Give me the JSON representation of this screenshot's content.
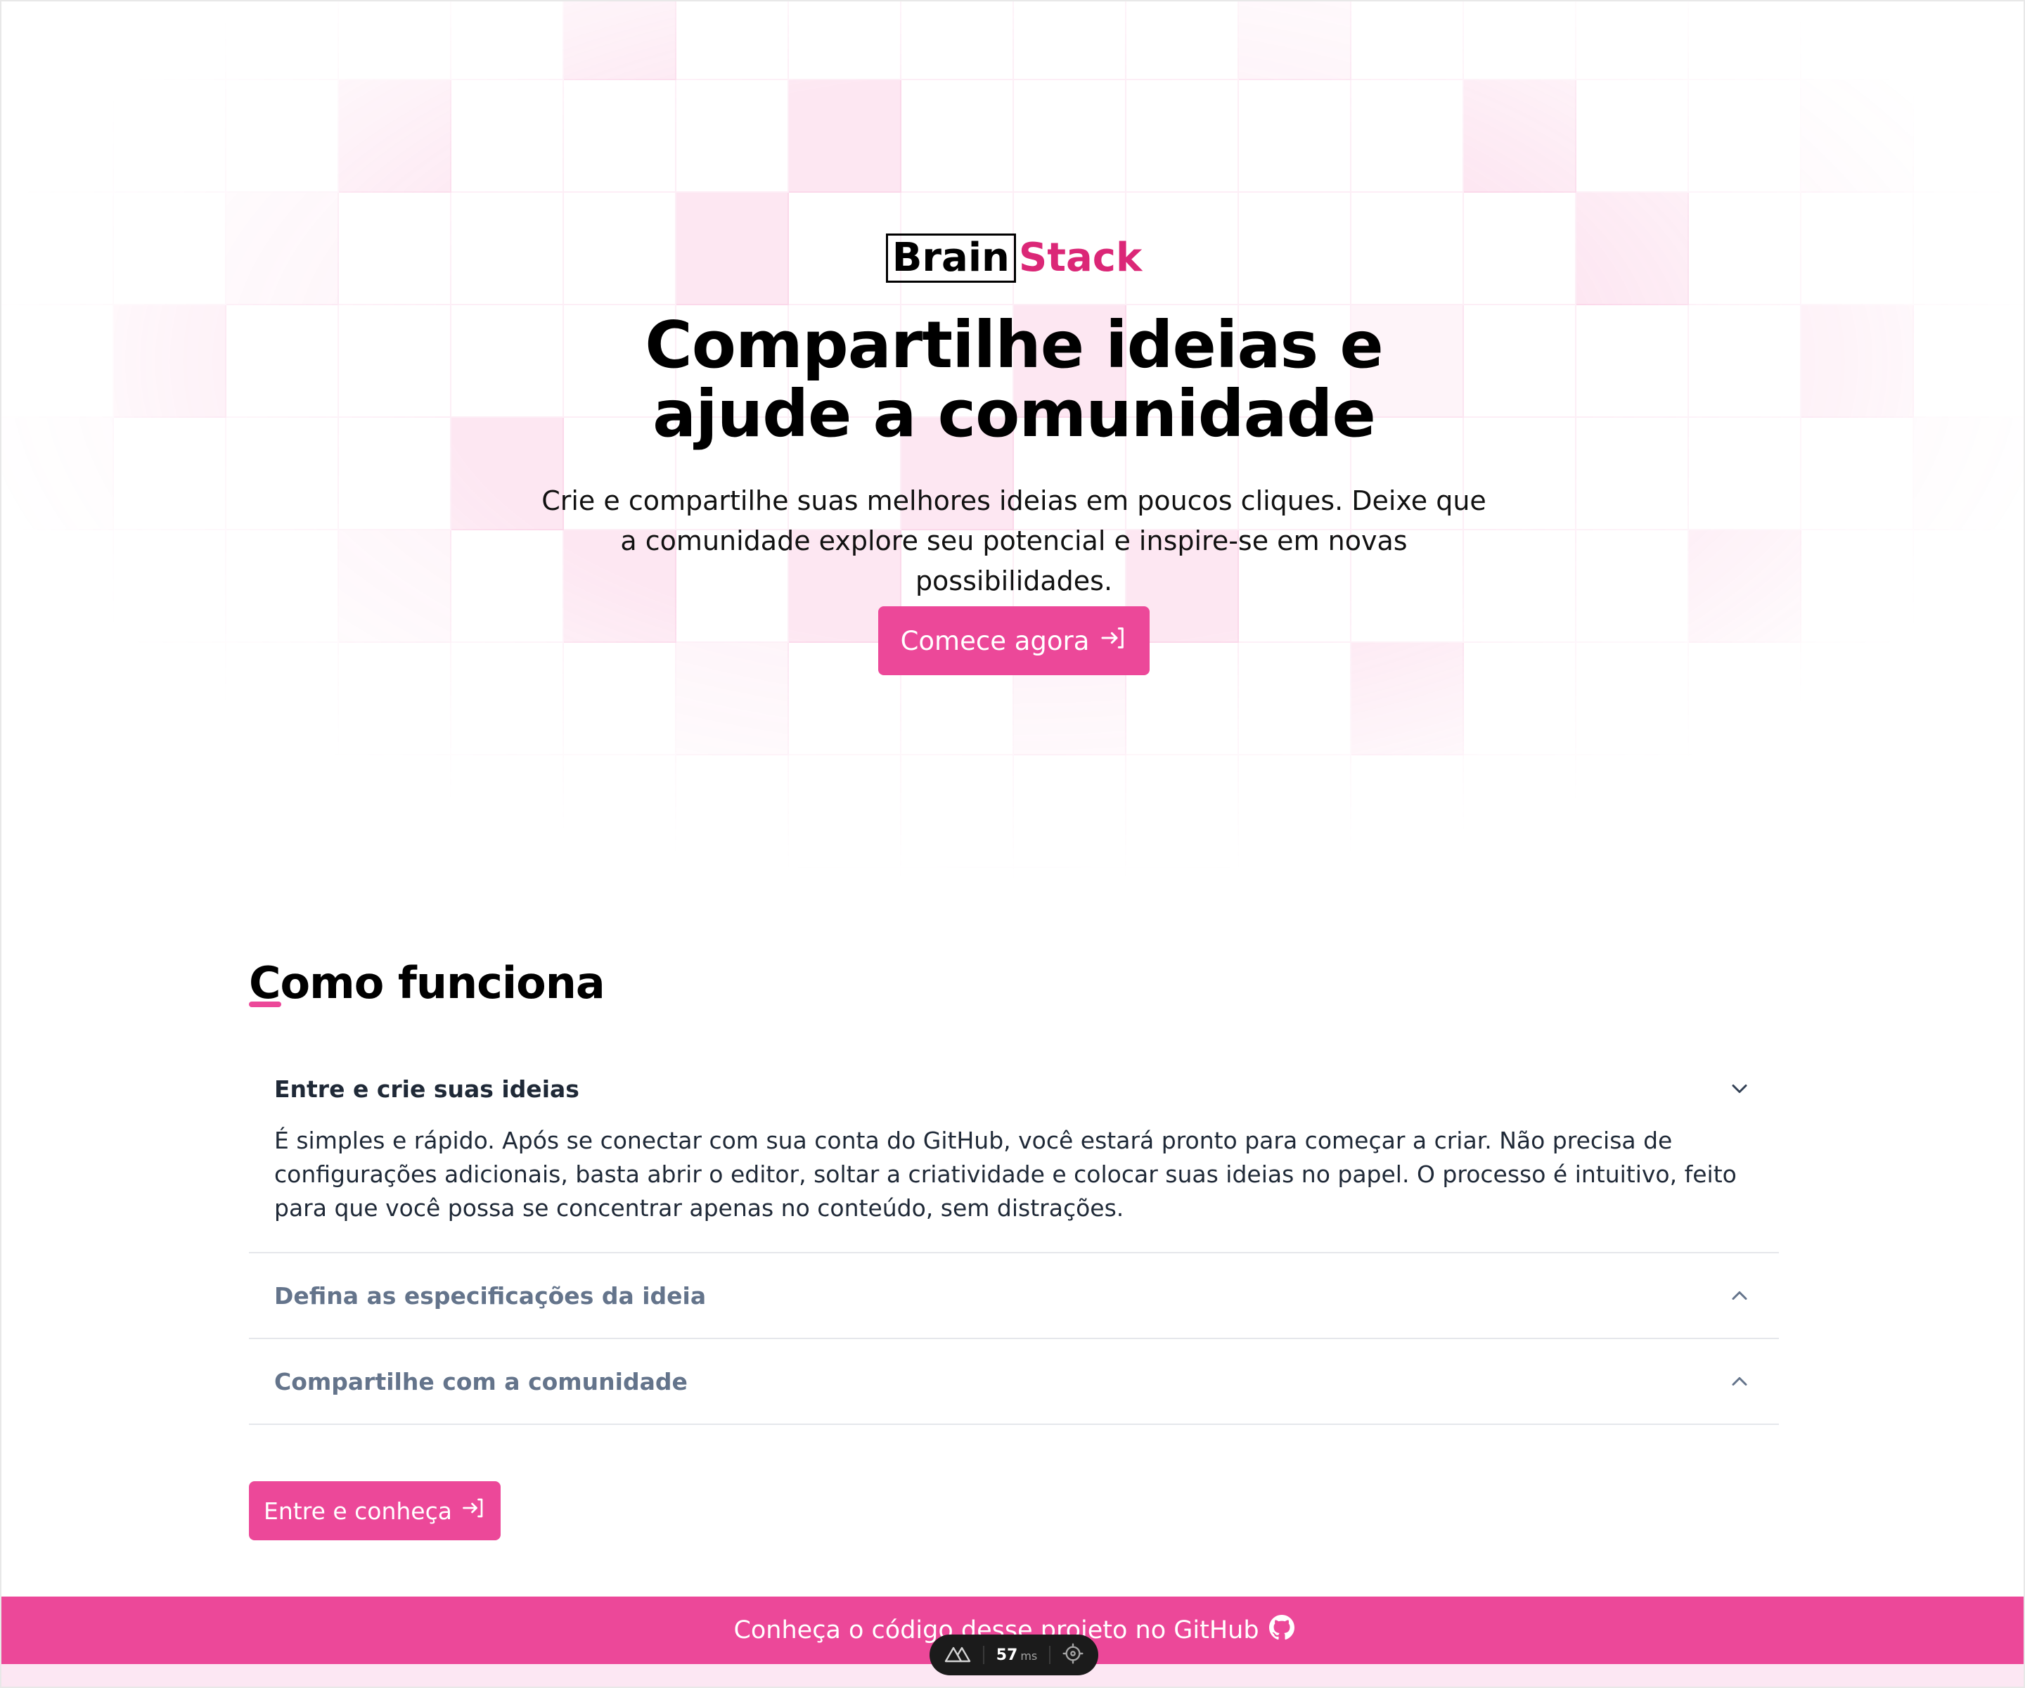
{
  "brand": {
    "part1": "Brain",
    "part2": "Stack",
    "accent_color": "#db2777"
  },
  "hero": {
    "title": "Compartilhe ideias e ajude a comunidade",
    "subtitle": "Crie e compartilhe suas melhores ideias em poucos cliques. Deixe que a comunidade explore seu potencial e inspire-se em novas possibilidades.",
    "cta_label": "Comece agora",
    "cta_icon": "arrow-right-to-bracket-icon"
  },
  "how_it_works": {
    "title": "Como funciona",
    "items": [
      {
        "title": "Entre e crie suas ideias",
        "expanded": true,
        "body": "É simples e rápido. Após se conectar com sua conta do GitHub, você estará pronto para começar a criar. Não precisa de configurações adicionais, basta abrir o editor, soltar a criatividade e colocar suas ideias no papel. O processo é intuitivo, feito para que você possa se concentrar apenas no conteúdo, sem distrações.",
        "icon": "chevron-down-icon"
      },
      {
        "title": "Defina as especificações da ideia",
        "expanded": false,
        "body": "",
        "icon": "chevron-up-icon"
      },
      {
        "title": "Compartilhe com a comunidade",
        "expanded": false,
        "body": "",
        "icon": "chevron-up-icon"
      }
    ],
    "cta_label": "Entre e conheça",
    "cta_icon": "arrow-right-to-bracket-icon"
  },
  "footer": {
    "text": "Conheça o código desse projeto no GitHub",
    "icon": "github-icon",
    "color": "#ec4899"
  },
  "devtools": {
    "time": "57",
    "unit": "ms",
    "logo_icon": "nuxt-logo-icon",
    "inspect_icon": "crosshair-icon"
  }
}
